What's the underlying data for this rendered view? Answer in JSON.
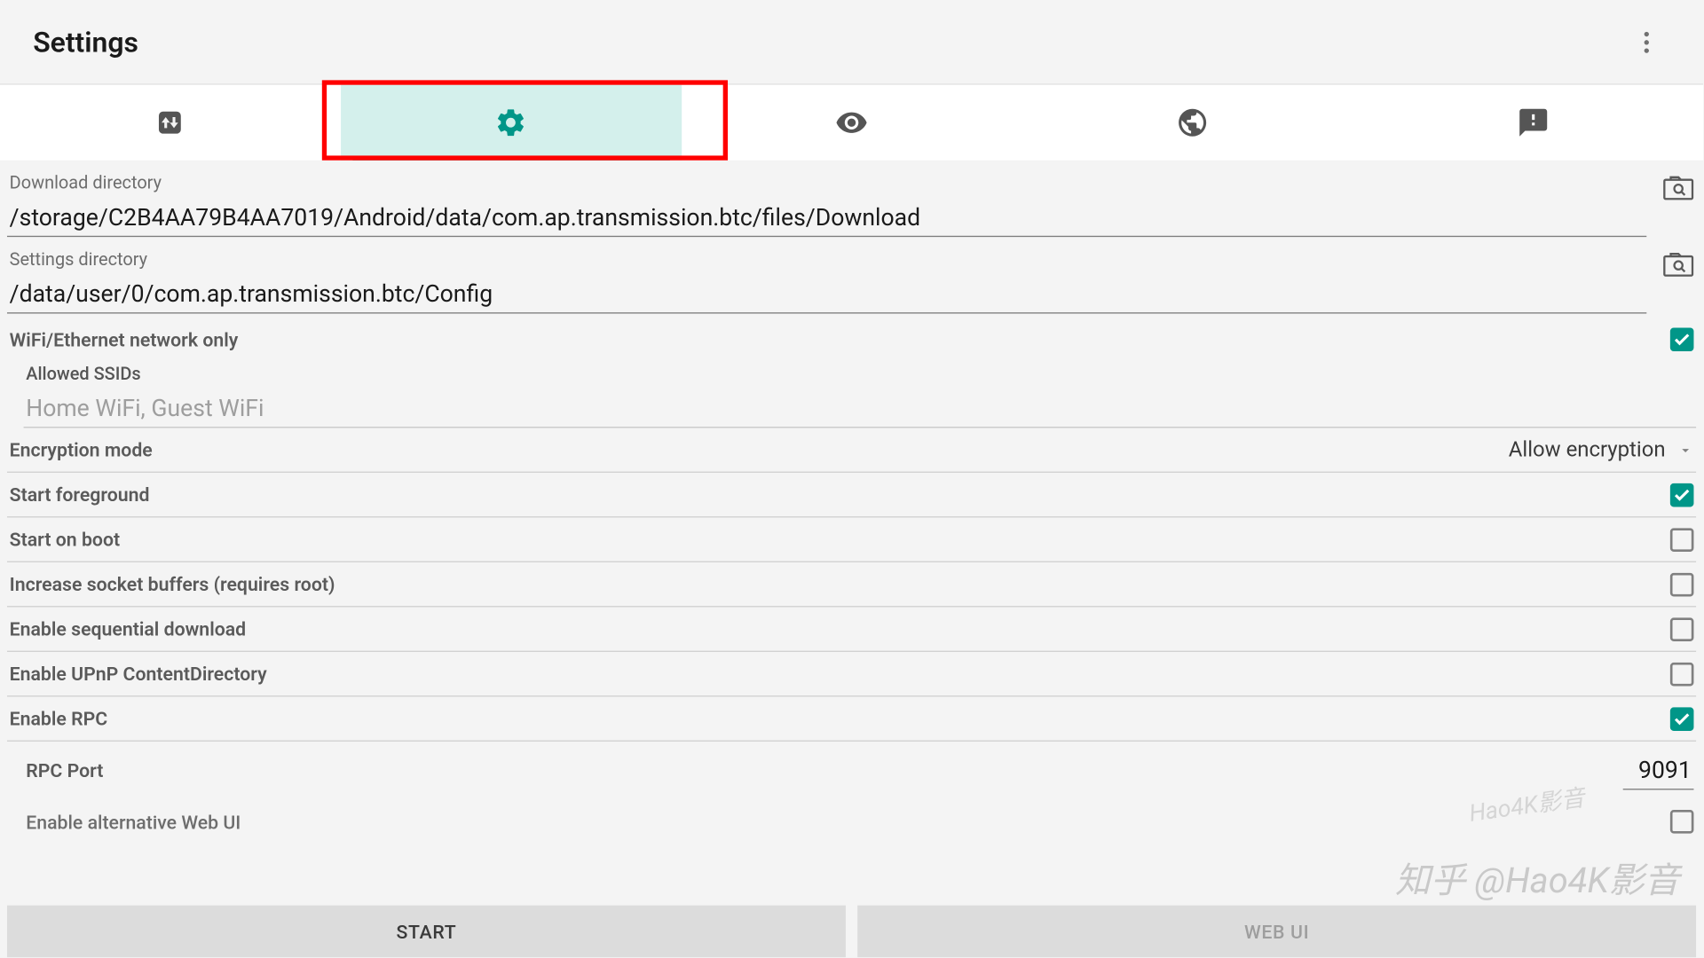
{
  "header": {
    "title": "Settings"
  },
  "tabs": {
    "active_index": 1
  },
  "fields": {
    "download_dir": {
      "label": "Download directory",
      "value": "/storage/C2B4AA79B4AA7019/Android/data/com.ap.transmission.btc/files/Download"
    },
    "settings_dir": {
      "label": "Settings directory",
      "value": "/data/user/0/com.ap.transmission.btc/Config"
    },
    "wifi_only": {
      "label": "WiFi/Ethernet network only",
      "checked": true
    },
    "allowed_ssids": {
      "label": "Allowed SSIDs",
      "placeholder": "Home WiFi, Guest WiFi",
      "value": ""
    },
    "encryption": {
      "label": "Encryption mode",
      "value": "Allow encryption"
    },
    "start_foreground": {
      "label": "Start foreground",
      "checked": true
    },
    "start_on_boot": {
      "label": "Start on boot",
      "checked": false
    },
    "increase_socket": {
      "label": "Increase socket buffers (requires root)",
      "checked": false
    },
    "sequential_dl": {
      "label": "Enable sequential download",
      "checked": false
    },
    "upnp_content": {
      "label": "Enable UPnP ContentDirectory",
      "checked": false
    },
    "enable_rpc": {
      "label": "Enable RPC",
      "checked": true
    },
    "rpc_port": {
      "label": "RPC Port",
      "value": "9091"
    },
    "alt_web_ui": {
      "label": "Enable alternative Web UI",
      "checked": false
    }
  },
  "buttons": {
    "start": "START",
    "webui": "WEB UI"
  },
  "watermark": {
    "small": "Hao4K影音",
    "large": "知乎 @Hao4K影音"
  }
}
